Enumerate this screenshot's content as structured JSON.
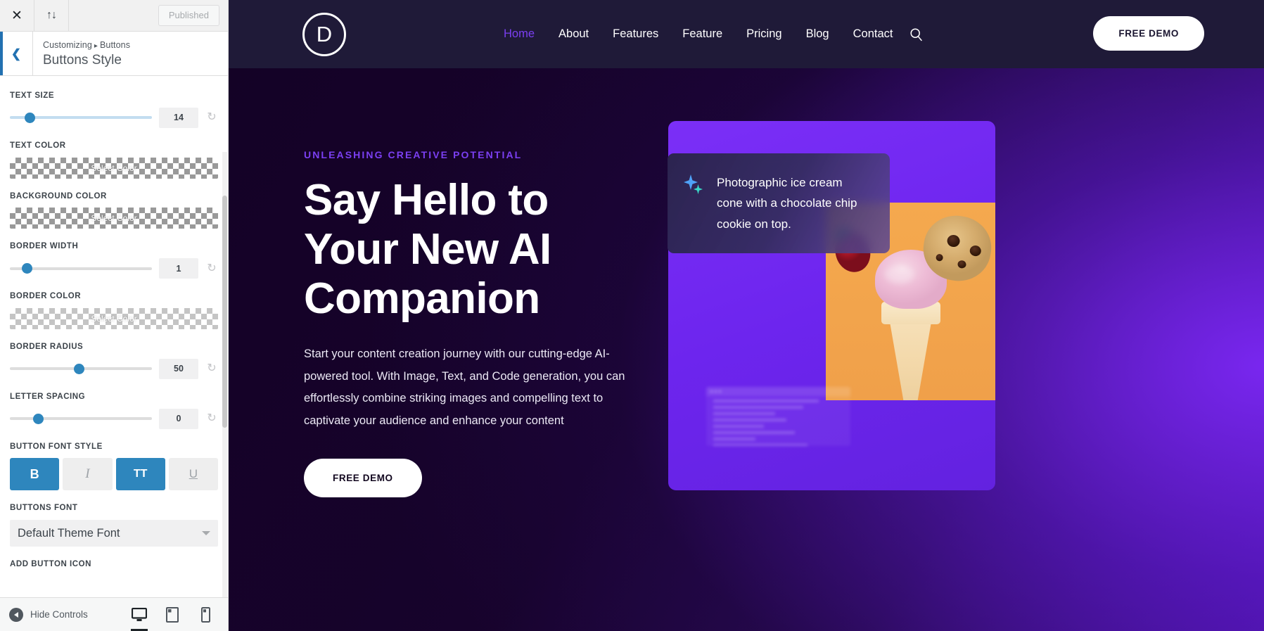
{
  "customizer": {
    "topbar": {
      "close_icon": "close-icon",
      "updown_icon": "collapse-toggle-icon",
      "published_label": "Published"
    },
    "header": {
      "back_icon": "chevron-left-icon",
      "breadcrumb_root": "Customizing",
      "breadcrumb_sep": "▸",
      "breadcrumb_section": "Buttons",
      "title": "Buttons Style"
    },
    "controls": [
      {
        "label": "TEXT SIZE",
        "type": "slider",
        "value": "14",
        "knob_pct": 14
      },
      {
        "label": "TEXT COLOR",
        "type": "color",
        "button_label": "Select Color"
      },
      {
        "label": "BACKGROUND COLOR",
        "type": "color",
        "button_label": "Select Color"
      },
      {
        "label": "BORDER WIDTH",
        "type": "slider",
        "value": "1",
        "knob_pct": 12
      },
      {
        "label": "BORDER COLOR",
        "type": "color",
        "button_label": "Select Color"
      },
      {
        "label": "BORDER RADIUS",
        "type": "slider",
        "value": "50",
        "knob_pct": 49
      },
      {
        "label": "LETTER SPACING",
        "type": "slider",
        "value": "0",
        "knob_pct": 20
      }
    ],
    "font_style": {
      "label": "BUTTON FONT STYLE",
      "buttons": [
        {
          "name": "bold",
          "glyph": "B",
          "active": true
        },
        {
          "name": "italic",
          "glyph": "I",
          "active": false
        },
        {
          "name": "uppercase",
          "glyph": "TT",
          "active": true
        },
        {
          "name": "underline",
          "glyph": "U",
          "active": false
        }
      ]
    },
    "buttons_font": {
      "label": "BUTTONS FONT",
      "selected": "Default Theme Font"
    },
    "add_button_icon_label": "ADD BUTTON ICON",
    "footer": {
      "hide_controls_label": "Hide Controls",
      "devices": [
        {
          "name": "desktop",
          "icon": "desktop-icon",
          "active": true
        },
        {
          "name": "tablet",
          "icon": "tablet-icon",
          "active": false
        },
        {
          "name": "mobile",
          "icon": "mobile-icon",
          "active": false
        }
      ]
    },
    "colors": {
      "accent": "#2e86bd",
      "link": "#2271b1"
    }
  },
  "site": {
    "logo_letter": "D",
    "nav_links": [
      {
        "label": "Home",
        "active": true
      },
      {
        "label": "About",
        "active": false
      },
      {
        "label": "Features",
        "active": false
      },
      {
        "label": "Feature",
        "active": false
      },
      {
        "label": "Pricing",
        "active": false
      },
      {
        "label": "Blog",
        "active": false
      },
      {
        "label": "Contact",
        "active": false
      }
    ],
    "search_icon": "search-icon",
    "nav_cta_label": "FREE DEMO",
    "hero": {
      "eyebrow": "UNLEASHING CREATIVE POTENTIAL",
      "title_line1": "Say Hello to",
      "title_line2": "Your New AI",
      "title_line3": "Companion",
      "description": "Start your content creation journey with our cutting-edge AI-powered tool. With Image, Text, and Code generation, you can effortlessly combine striking images and compelling text to captivate your audience and enhance your content",
      "cta_label": "FREE DEMO"
    },
    "artwork": {
      "prompt_icon": "sparkle-icon",
      "prompt_text": "Photographic ice cream cone with a chocolate chip cookie on top.",
      "photo_alt": "ice-cream-cone-photo"
    },
    "colors": {
      "nav_bg": "#1f1a38",
      "accent_purple": "#7b3ff2",
      "card_purple": "#7b2ff7",
      "photo_orange": "#f0a04a"
    }
  }
}
